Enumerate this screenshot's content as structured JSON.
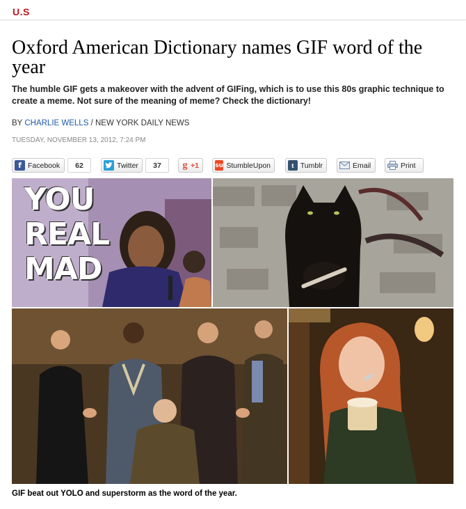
{
  "section": {
    "label": "U.S"
  },
  "article": {
    "headline": "Oxford American Dictionary names GIF word of the year",
    "dek": "The humble GIF gets a makeover with the advent of GIFing, which is to use this 80s graphic technique to create a meme. Not sure of the meaning of meme? Check the dictionary!",
    "byline_prefix": "BY",
    "author": "CHARLIE WELLS",
    "byline_separator": " / ",
    "outlet": "NEW YORK DAILY NEWS",
    "date": "TUESDAY, NOVEMBER 13, 2012, 7:24 PM",
    "caption": "GIF beat out YOLO and superstorm as the word of the year."
  },
  "share": {
    "facebook": {
      "label": "Facebook",
      "count": "62",
      "icon": "facebook-icon",
      "color": "#3b5998"
    },
    "twitter": {
      "label": "Twitter",
      "count": "37",
      "icon": "twitter-icon",
      "color": "#2a9fd8"
    },
    "gplus": {
      "label": "+1",
      "glyph": "g",
      "icon": "google-plus-icon",
      "color": "#dd4b39"
    },
    "stumbleupon": {
      "label": "StumbleUpon",
      "icon": "stumbleupon-icon",
      "color": "#eb4924"
    },
    "tumblr": {
      "label": "Tumblr",
      "glyph": "t",
      "icon": "tumblr-icon",
      "color": "#34526f"
    },
    "email": {
      "label": "Email",
      "icon": "envelope-icon"
    },
    "print": {
      "label": "Print",
      "icon": "printer-icon"
    }
  },
  "collage": {
    "meme_text": [
      "YOU",
      "REAL",
      "MAD"
    ]
  },
  "colors": {
    "accent": "#c4161c",
    "link": "#1c5aa6"
  }
}
